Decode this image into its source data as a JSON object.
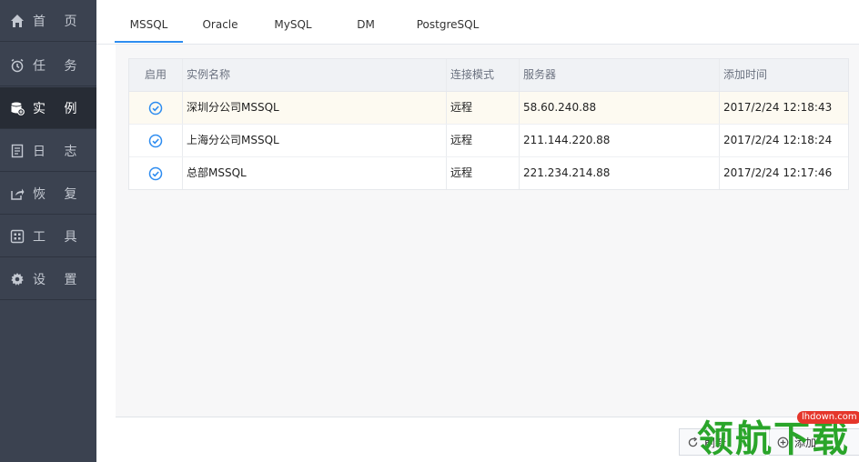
{
  "sidebar": {
    "items": [
      {
        "label": "首 页",
        "icon": "home-icon"
      },
      {
        "label": "任 务",
        "icon": "alarm-clock-icon"
      },
      {
        "label": "实 例",
        "icon": "database-icon",
        "active": true
      },
      {
        "label": "日 志",
        "icon": "log-document-icon"
      },
      {
        "label": "恢 复",
        "icon": "share-export-icon"
      },
      {
        "label": "工 具",
        "icon": "tools-grid-icon"
      },
      {
        "label": "设 置",
        "icon": "gear-icon"
      }
    ]
  },
  "tabs": [
    {
      "label": "MSSQL",
      "active": true
    },
    {
      "label": "Oracle"
    },
    {
      "label": "MySQL"
    },
    {
      "label": "DM"
    },
    {
      "label": "PostgreSQL"
    }
  ],
  "table": {
    "headers": [
      "启用",
      "实例名称",
      "连接模式",
      "服务器",
      "添加时间"
    ],
    "rows": [
      {
        "enabled": true,
        "name": "深圳分公司MSSQL",
        "mode": "远程",
        "server": "58.60.240.88",
        "added": "2017/2/24 12:18:43",
        "selected": true
      },
      {
        "enabled": true,
        "name": "上海分公司MSSQL",
        "mode": "远程",
        "server": "211.144.220.88",
        "added": "2017/2/24 12:18:24"
      },
      {
        "enabled": true,
        "name": "总部MSSQL",
        "mode": "远程",
        "server": "221.234.214.88",
        "added": "2017/2/24 12:17:46"
      }
    ]
  },
  "footer": {
    "refresh_label": "刷新",
    "add_label": "添加"
  },
  "watermark": {
    "text": "领航下载",
    "url": "lhdown.com"
  },
  "colors": {
    "sidebar_bg": "#3b4250",
    "sidebar_active": "#272c35",
    "accent": "#2d8cf0",
    "check": "#2d8cf0"
  }
}
